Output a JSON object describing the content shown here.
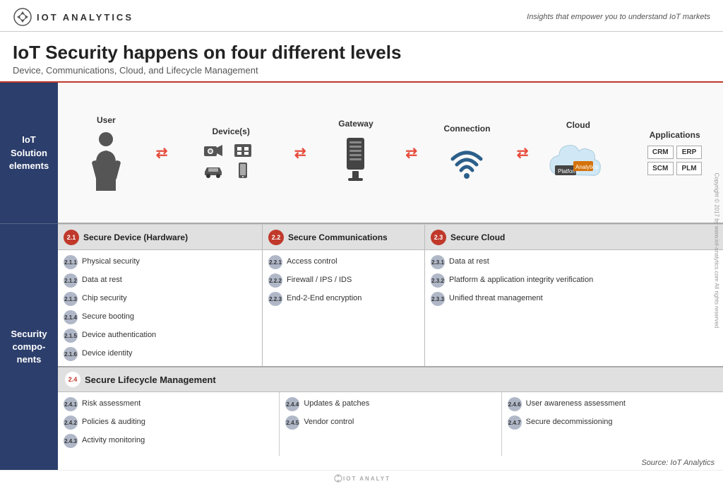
{
  "header": {
    "logo_text": "IOT ANALYTICS",
    "tagline": "Insights that empower you to understand IoT markets"
  },
  "title": {
    "main": "IoT Security happens on four different levels",
    "sub": "Device, Communications, Cloud, and Lifecycle Management"
  },
  "diagram": {
    "left_label_top": "IoT Solution elements",
    "left_label_bottom": "Security compo-nents",
    "columns": [
      {
        "label": "User"
      },
      {
        "label": "Device(s)"
      },
      {
        "label": "Gateway"
      },
      {
        "label": "Connection"
      },
      {
        "label": "Cloud"
      },
      {
        "label": "Applications"
      }
    ],
    "apps": [
      "CRM",
      "ERP",
      "SCM",
      "PLM"
    ]
  },
  "sections": {
    "device": {
      "badge": "2.1",
      "title": "Secure Device (Hardware)",
      "items": [
        {
          "num": "2.1.1",
          "text": "Physical security"
        },
        {
          "num": "2.1.2",
          "text": "Data at rest"
        },
        {
          "num": "2.1.3",
          "text": "Chip security"
        },
        {
          "num": "2.1.4",
          "text": "Secure booting"
        },
        {
          "num": "2.1.5",
          "text": "Device authentication"
        },
        {
          "num": "2.1.6",
          "text": "Device identity"
        }
      ]
    },
    "comms": {
      "badge": "2.2",
      "title": "Secure Communications",
      "items": [
        {
          "num": "2.2.1",
          "text": "Access control"
        },
        {
          "num": "2.2.2",
          "text": "Firewall / IPS / IDS"
        },
        {
          "num": "2.2.3",
          "text": "End-2-End encryption"
        }
      ]
    },
    "cloud": {
      "badge": "2.3",
      "title": "Secure Cloud",
      "items": [
        {
          "num": "2.3.1",
          "text": "Data at rest"
        },
        {
          "num": "2.3.2",
          "text": "Platform & application integrity verification"
        },
        {
          "num": "2.3.3",
          "text": "Unified threat management"
        }
      ]
    }
  },
  "lifecycle": {
    "badge": "2.4",
    "title": "Secure Lifecycle Management",
    "col1": [
      {
        "num": "2.4.1",
        "text": "Risk assessment"
      },
      {
        "num": "2.4.2",
        "text": "Policies & auditing"
      },
      {
        "num": "2.4.3",
        "text": "Activity monitoring"
      }
    ],
    "col2": [
      {
        "num": "2.4.4",
        "text": "Updates & patches"
      },
      {
        "num": "2.4.5",
        "text": "Vendor control"
      }
    ],
    "col3": [
      {
        "num": "2.4.6",
        "text": "User awareness assessment"
      },
      {
        "num": "2.4.7",
        "text": "Secure decommissioning"
      }
    ]
  },
  "source": "Source: IoT Analytics",
  "copyright": "Copyright © 2017 by www.iot-analytics.com All rights reserved"
}
